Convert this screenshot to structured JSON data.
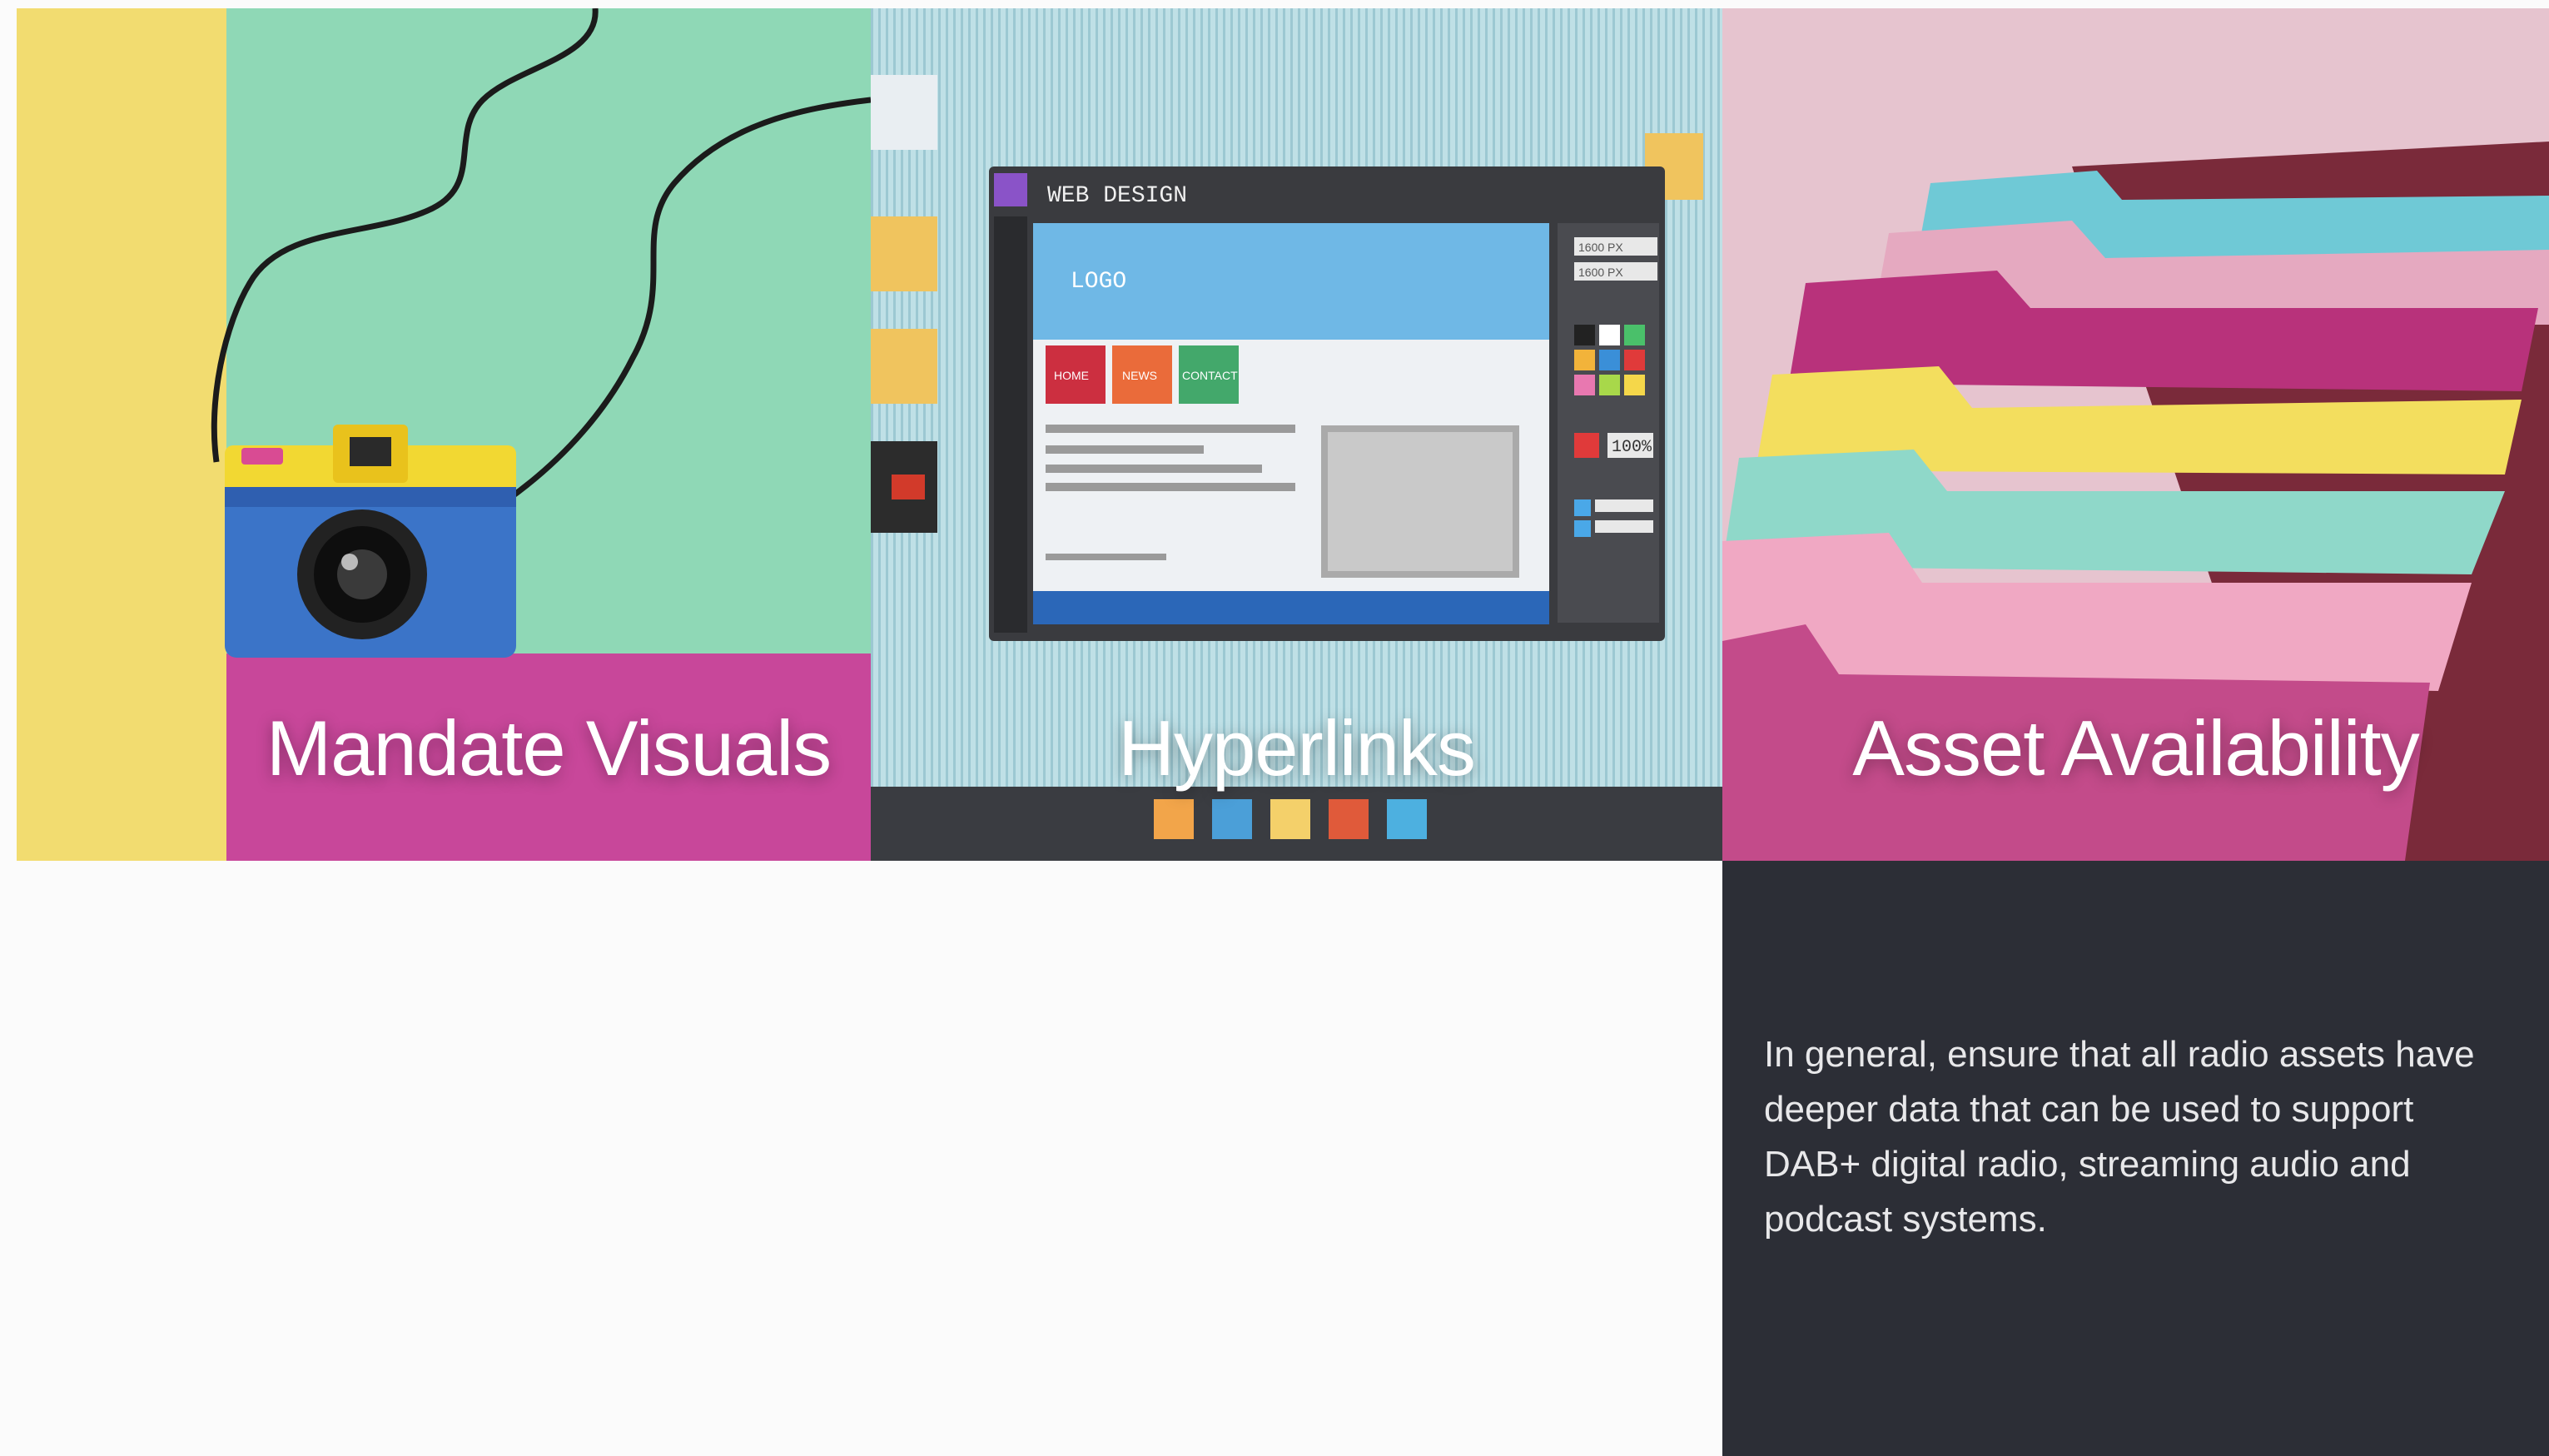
{
  "tiles": [
    {
      "title": "Mandate Visuals",
      "image": "camera-on-colored-paper-photo"
    },
    {
      "title": "Hyperlinks",
      "image": "web-design-paper-craft-photo"
    },
    {
      "title": "Asset Availability",
      "image": "colored-file-folders-photo"
    }
  ],
  "mockup": {
    "window_title": "WEB DESIGN",
    "logo": "LOGO",
    "nav": [
      "HOME",
      "NEWS",
      "CONTACT"
    ],
    "fields": [
      "1600 PX",
      "1600 PX"
    ],
    "zoom": "100%"
  },
  "info": {
    "text": "In general, ensure that all radio assets have deeper data that can be used to support DAB+ digital radio, streaming audio and podcast systems."
  },
  "colors": {
    "panel_bg": "#2c2e36",
    "page_bg": "#fbfbfb",
    "yellow": "#f3dc6e",
    "mint": "#8fd8b6",
    "magenta": "#c8469a",
    "pink": "#e6c4cf"
  }
}
